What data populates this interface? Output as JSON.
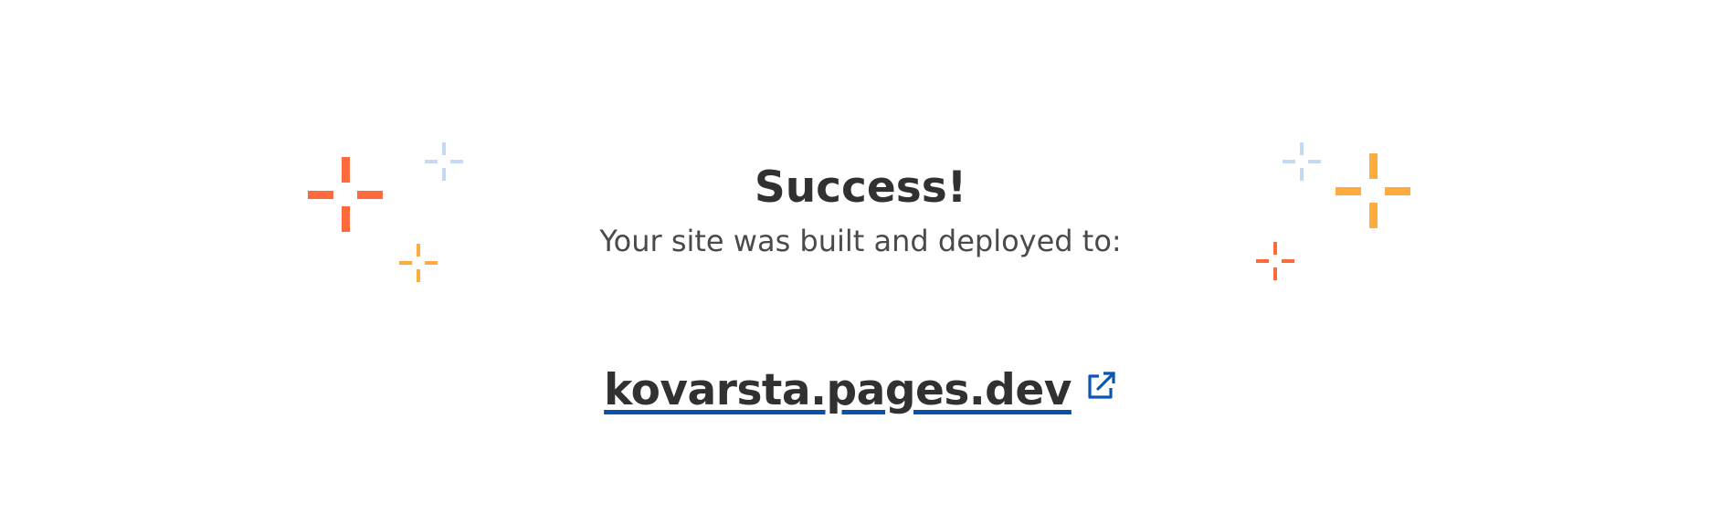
{
  "success": {
    "title": "Success!",
    "subtitle": "Your site was built and deployed to:"
  },
  "deployment": {
    "url_text": "kovarsta.pages.dev",
    "external_link_icon": "external-link-icon"
  },
  "colors": {
    "orange": "#ff6a3d",
    "amber": "#ffac3f",
    "light_blue": "#c5d9f7",
    "link_underline": "#0a4fa8",
    "icon_blue": "#0a55b5",
    "text": "#313131"
  },
  "decorations": [
    "sparkle-icon-orange",
    "sparkle-icon-light-blue",
    "sparkle-icon-amber"
  ]
}
